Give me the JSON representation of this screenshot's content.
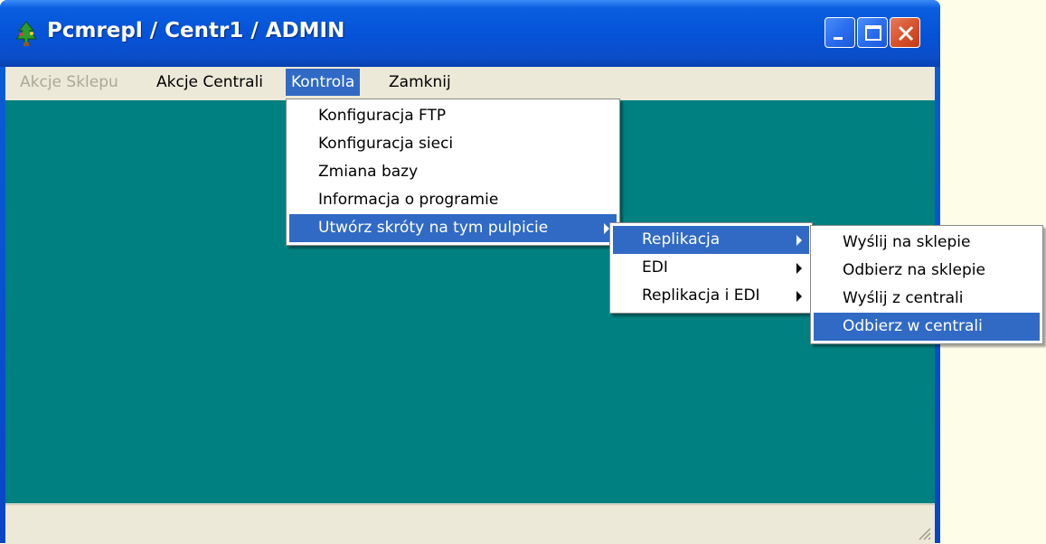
{
  "window": {
    "title": "Pcmrepl / Centr1 / ADMIN",
    "icon": "tree-app-icon",
    "controls": [
      "minimize-icon",
      "maximize-icon",
      "close-icon"
    ]
  },
  "menubar": {
    "items": [
      {
        "label": "Akcje Sklepu",
        "state": "disabled"
      },
      {
        "label": "Akcje Centrali",
        "state": "normal"
      },
      {
        "label": "Kontrola",
        "state": "active"
      },
      {
        "label": "Zamknij",
        "state": "normal"
      }
    ]
  },
  "kontrola_menu": {
    "items": [
      {
        "label": "Konfiguracja FTP"
      },
      {
        "label": "Konfiguracja sieci"
      },
      {
        "label": "Zmiana bazy"
      },
      {
        "label": "Informacja o programie"
      },
      {
        "label": "Utwórz skróty na tym pulpicie",
        "submenu": true,
        "highlighted": true
      }
    ]
  },
  "shortcuts_menu": {
    "items": [
      {
        "label": "Replikacja",
        "submenu": true,
        "highlighted": true
      },
      {
        "label": "EDI",
        "submenu": true
      },
      {
        "label": "Replikacja i EDI",
        "submenu": true
      }
    ]
  },
  "replikacja_menu": {
    "items": [
      {
        "label": "Wyślij na sklepie"
      },
      {
        "label": "Odbierz na sklepie"
      },
      {
        "label": "Wyślij z centrali"
      },
      {
        "label": "Odbierz w centrali",
        "highlighted": true
      }
    ]
  },
  "colors": {
    "workspace": "#008080",
    "highlight": "#316ac5",
    "menubar": "#ece9d8",
    "titlebar": "#0a5fe0"
  }
}
